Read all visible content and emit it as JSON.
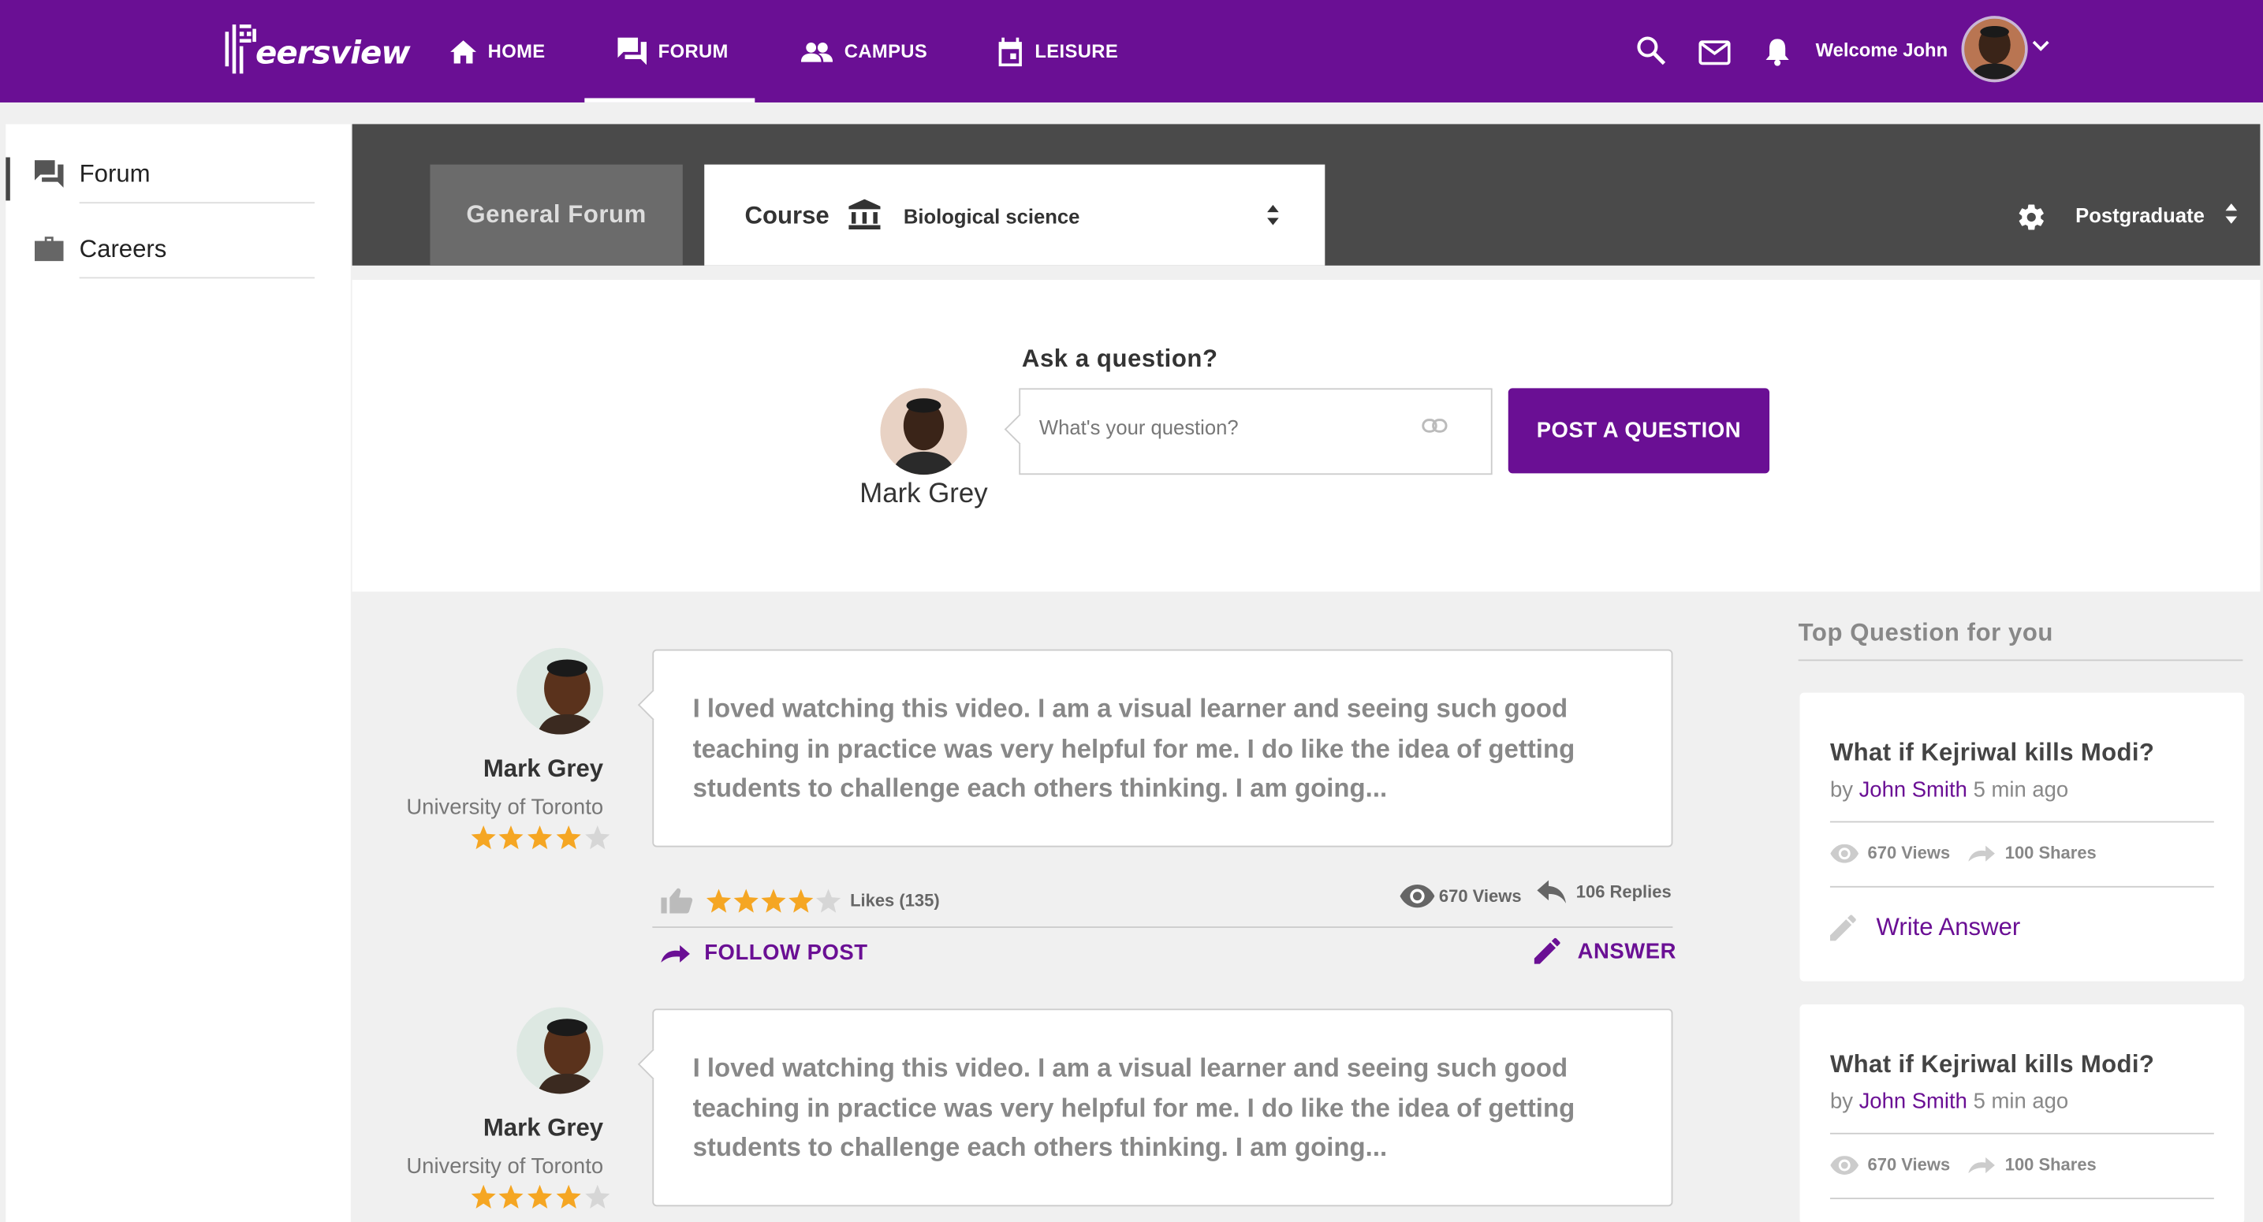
{
  "brand": {
    "name": "eersview",
    "accent": "#6a0f94"
  },
  "nav": {
    "home": "HOME",
    "forum": "FORUM",
    "campus": "CAMPUS",
    "leisure": "LEISURE",
    "active": "forum"
  },
  "user": {
    "welcome": "Welcome John"
  },
  "sidebar": {
    "items": [
      {
        "label": "Forum",
        "icon": "chat-icon",
        "selected": true
      },
      {
        "label": "Careers",
        "icon": "briefcase-icon",
        "selected": false
      }
    ]
  },
  "forum_header": {
    "general_tab": "General Forum",
    "course_label": "Course",
    "course_value": "Biological science",
    "level": "Postgraduate"
  },
  "ask": {
    "title": "Ask a question?",
    "user_name": "Mark Grey",
    "placeholder": "What's your question?",
    "button": "POST A QUESTION"
  },
  "posts": [
    {
      "name": "Mark Grey",
      "university": "University of Toronto",
      "rating": 4,
      "text": "I loved watching this video. I am a visual learner and seeing such good teaching in practice was very helpful for me. I do like the idea of getting students to challenge each others thinking. I am going...",
      "post_rating": 4,
      "likes": "Likes (135)",
      "views": "670 Views",
      "replies": "106 Replies",
      "follow": "FOLLOW POST",
      "answer": "ANSWER"
    },
    {
      "name": "Mark Grey",
      "university": "University of Toronto",
      "rating": 4,
      "text": "I loved watching this video. I am a visual learner and seeing such good teaching in practice was very helpful for me. I do like the idea of getting students to challenge each others thinking. I am going..."
    }
  ],
  "top_questions": {
    "title": "Top Question for you",
    "items": [
      {
        "question": "What if Kejriwal kills Modi?",
        "by": "by",
        "author": "John Smith",
        "time": "5 min ago",
        "views": "670 Views",
        "shares": "100 Shares",
        "write": "Write Answer"
      },
      {
        "question": "What if Kejriwal kills Modi?",
        "by": "by",
        "author": "John Smith",
        "time": "5 min ago",
        "views": "670 Views",
        "shares": "100 Shares"
      }
    ]
  }
}
